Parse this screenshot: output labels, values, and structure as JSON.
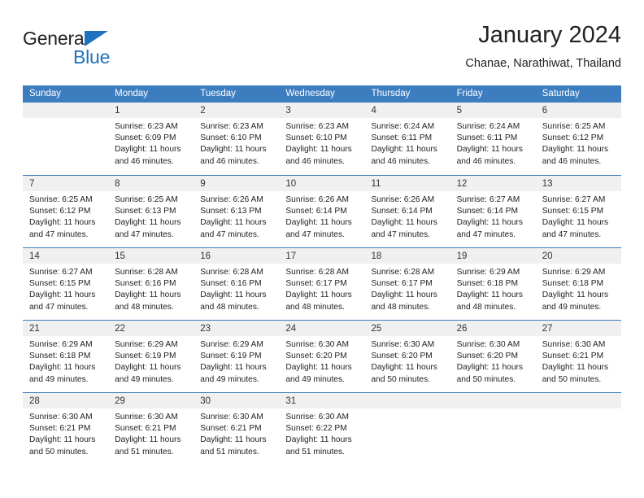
{
  "brand": {
    "name_part1": "General",
    "name_part2": "Blue",
    "color_dark": "#231F20",
    "color_blue": "#1F72BD"
  },
  "header": {
    "title": "January 2024",
    "subtitle": "Chanae, Narathiwat, Thailand"
  },
  "theme": {
    "header_row_bg": "#3C7DC0",
    "daynum_band_bg": "#F0F0F0",
    "grid_line": "#3C7DC0"
  },
  "weekday_headers": [
    "Sunday",
    "Monday",
    "Tuesday",
    "Wednesday",
    "Thursday",
    "Friday",
    "Saturday"
  ],
  "weeks": [
    [
      {
        "day": "",
        "sunrise": "",
        "sunset": "",
        "daylight_line1": "",
        "daylight_line2": ""
      },
      {
        "day": "1",
        "sunrise": "Sunrise: 6:23 AM",
        "sunset": "Sunset: 6:09 PM",
        "daylight_line1": "Daylight: 11 hours",
        "daylight_line2": "and 46 minutes."
      },
      {
        "day": "2",
        "sunrise": "Sunrise: 6:23 AM",
        "sunset": "Sunset: 6:10 PM",
        "daylight_line1": "Daylight: 11 hours",
        "daylight_line2": "and 46 minutes."
      },
      {
        "day": "3",
        "sunrise": "Sunrise: 6:23 AM",
        "sunset": "Sunset: 6:10 PM",
        "daylight_line1": "Daylight: 11 hours",
        "daylight_line2": "and 46 minutes."
      },
      {
        "day": "4",
        "sunrise": "Sunrise: 6:24 AM",
        "sunset": "Sunset: 6:11 PM",
        "daylight_line1": "Daylight: 11 hours",
        "daylight_line2": "and 46 minutes."
      },
      {
        "day": "5",
        "sunrise": "Sunrise: 6:24 AM",
        "sunset": "Sunset: 6:11 PM",
        "daylight_line1": "Daylight: 11 hours",
        "daylight_line2": "and 46 minutes."
      },
      {
        "day": "6",
        "sunrise": "Sunrise: 6:25 AM",
        "sunset": "Sunset: 6:12 PM",
        "daylight_line1": "Daylight: 11 hours",
        "daylight_line2": "and 46 minutes."
      }
    ],
    [
      {
        "day": "7",
        "sunrise": "Sunrise: 6:25 AM",
        "sunset": "Sunset: 6:12 PM",
        "daylight_line1": "Daylight: 11 hours",
        "daylight_line2": "and 47 minutes."
      },
      {
        "day": "8",
        "sunrise": "Sunrise: 6:25 AM",
        "sunset": "Sunset: 6:13 PM",
        "daylight_line1": "Daylight: 11 hours",
        "daylight_line2": "and 47 minutes."
      },
      {
        "day": "9",
        "sunrise": "Sunrise: 6:26 AM",
        "sunset": "Sunset: 6:13 PM",
        "daylight_line1": "Daylight: 11 hours",
        "daylight_line2": "and 47 minutes."
      },
      {
        "day": "10",
        "sunrise": "Sunrise: 6:26 AM",
        "sunset": "Sunset: 6:14 PM",
        "daylight_line1": "Daylight: 11 hours",
        "daylight_line2": "and 47 minutes."
      },
      {
        "day": "11",
        "sunrise": "Sunrise: 6:26 AM",
        "sunset": "Sunset: 6:14 PM",
        "daylight_line1": "Daylight: 11 hours",
        "daylight_line2": "and 47 minutes."
      },
      {
        "day": "12",
        "sunrise": "Sunrise: 6:27 AM",
        "sunset": "Sunset: 6:14 PM",
        "daylight_line1": "Daylight: 11 hours",
        "daylight_line2": "and 47 minutes."
      },
      {
        "day": "13",
        "sunrise": "Sunrise: 6:27 AM",
        "sunset": "Sunset: 6:15 PM",
        "daylight_line1": "Daylight: 11 hours",
        "daylight_line2": "and 47 minutes."
      }
    ],
    [
      {
        "day": "14",
        "sunrise": "Sunrise: 6:27 AM",
        "sunset": "Sunset: 6:15 PM",
        "daylight_line1": "Daylight: 11 hours",
        "daylight_line2": "and 47 minutes."
      },
      {
        "day": "15",
        "sunrise": "Sunrise: 6:28 AM",
        "sunset": "Sunset: 6:16 PM",
        "daylight_line1": "Daylight: 11 hours",
        "daylight_line2": "and 48 minutes."
      },
      {
        "day": "16",
        "sunrise": "Sunrise: 6:28 AM",
        "sunset": "Sunset: 6:16 PM",
        "daylight_line1": "Daylight: 11 hours",
        "daylight_line2": "and 48 minutes."
      },
      {
        "day": "17",
        "sunrise": "Sunrise: 6:28 AM",
        "sunset": "Sunset: 6:17 PM",
        "daylight_line1": "Daylight: 11 hours",
        "daylight_line2": "and 48 minutes."
      },
      {
        "day": "18",
        "sunrise": "Sunrise: 6:28 AM",
        "sunset": "Sunset: 6:17 PM",
        "daylight_line1": "Daylight: 11 hours",
        "daylight_line2": "and 48 minutes."
      },
      {
        "day": "19",
        "sunrise": "Sunrise: 6:29 AM",
        "sunset": "Sunset: 6:18 PM",
        "daylight_line1": "Daylight: 11 hours",
        "daylight_line2": "and 48 minutes."
      },
      {
        "day": "20",
        "sunrise": "Sunrise: 6:29 AM",
        "sunset": "Sunset: 6:18 PM",
        "daylight_line1": "Daylight: 11 hours",
        "daylight_line2": "and 49 minutes."
      }
    ],
    [
      {
        "day": "21",
        "sunrise": "Sunrise: 6:29 AM",
        "sunset": "Sunset: 6:18 PM",
        "daylight_line1": "Daylight: 11 hours",
        "daylight_line2": "and 49 minutes."
      },
      {
        "day": "22",
        "sunrise": "Sunrise: 6:29 AM",
        "sunset": "Sunset: 6:19 PM",
        "daylight_line1": "Daylight: 11 hours",
        "daylight_line2": "and 49 minutes."
      },
      {
        "day": "23",
        "sunrise": "Sunrise: 6:29 AM",
        "sunset": "Sunset: 6:19 PM",
        "daylight_line1": "Daylight: 11 hours",
        "daylight_line2": "and 49 minutes."
      },
      {
        "day": "24",
        "sunrise": "Sunrise: 6:30 AM",
        "sunset": "Sunset: 6:20 PM",
        "daylight_line1": "Daylight: 11 hours",
        "daylight_line2": "and 49 minutes."
      },
      {
        "day": "25",
        "sunrise": "Sunrise: 6:30 AM",
        "sunset": "Sunset: 6:20 PM",
        "daylight_line1": "Daylight: 11 hours",
        "daylight_line2": "and 50 minutes."
      },
      {
        "day": "26",
        "sunrise": "Sunrise: 6:30 AM",
        "sunset": "Sunset: 6:20 PM",
        "daylight_line1": "Daylight: 11 hours",
        "daylight_line2": "and 50 minutes."
      },
      {
        "day": "27",
        "sunrise": "Sunrise: 6:30 AM",
        "sunset": "Sunset: 6:21 PM",
        "daylight_line1": "Daylight: 11 hours",
        "daylight_line2": "and 50 minutes."
      }
    ],
    [
      {
        "day": "28",
        "sunrise": "Sunrise: 6:30 AM",
        "sunset": "Sunset: 6:21 PM",
        "daylight_line1": "Daylight: 11 hours",
        "daylight_line2": "and 50 minutes."
      },
      {
        "day": "29",
        "sunrise": "Sunrise: 6:30 AM",
        "sunset": "Sunset: 6:21 PM",
        "daylight_line1": "Daylight: 11 hours",
        "daylight_line2": "and 51 minutes."
      },
      {
        "day": "30",
        "sunrise": "Sunrise: 6:30 AM",
        "sunset": "Sunset: 6:21 PM",
        "daylight_line1": "Daylight: 11 hours",
        "daylight_line2": "and 51 minutes."
      },
      {
        "day": "31",
        "sunrise": "Sunrise: 6:30 AM",
        "sunset": "Sunset: 6:22 PM",
        "daylight_line1": "Daylight: 11 hours",
        "daylight_line2": "and 51 minutes."
      },
      {
        "day": "",
        "sunrise": "",
        "sunset": "",
        "daylight_line1": "",
        "daylight_line2": ""
      },
      {
        "day": "",
        "sunrise": "",
        "sunset": "",
        "daylight_line1": "",
        "daylight_line2": ""
      },
      {
        "day": "",
        "sunrise": "",
        "sunset": "",
        "daylight_line1": "",
        "daylight_line2": ""
      }
    ]
  ]
}
